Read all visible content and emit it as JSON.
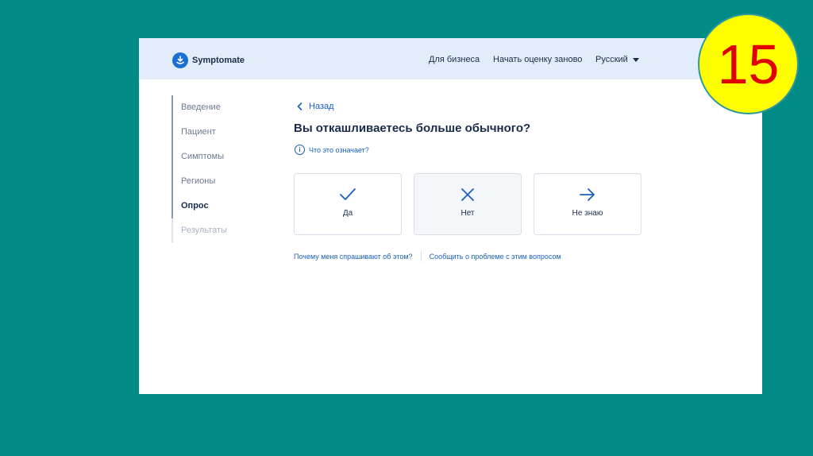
{
  "header": {
    "logo_text": "Symptomate",
    "nav": [
      "Для бизнеса",
      "Начать оценку заново",
      "Русский"
    ]
  },
  "steps": [
    {
      "label": "Введение",
      "state": "done"
    },
    {
      "label": "Пациент",
      "state": "done"
    },
    {
      "label": "Симптомы",
      "state": "done"
    },
    {
      "label": "Регионы",
      "state": "done"
    },
    {
      "label": "Опрос",
      "state": "active"
    },
    {
      "label": "Результаты",
      "state": "future"
    }
  ],
  "main": {
    "back_label": "Назад",
    "question": "Вы откашливаетесь больше обычного?",
    "what_means": "Что это означает?",
    "answers": [
      {
        "label": "Да",
        "icon": "check-icon"
      },
      {
        "label": "Нет",
        "icon": "x-icon"
      },
      {
        "label": "Не знаю",
        "icon": "arrow-right-icon"
      }
    ],
    "why_link": "Почему меня спрашивают об этом?",
    "report_link": "Сообщить о проблеме с этим вопросом"
  },
  "slide_number": "15",
  "colors": {
    "background": "#008b87",
    "header": "#e3edfa",
    "accent": "#1a6fd6",
    "badge": "#ffff00",
    "badge_text": "#e00000"
  }
}
